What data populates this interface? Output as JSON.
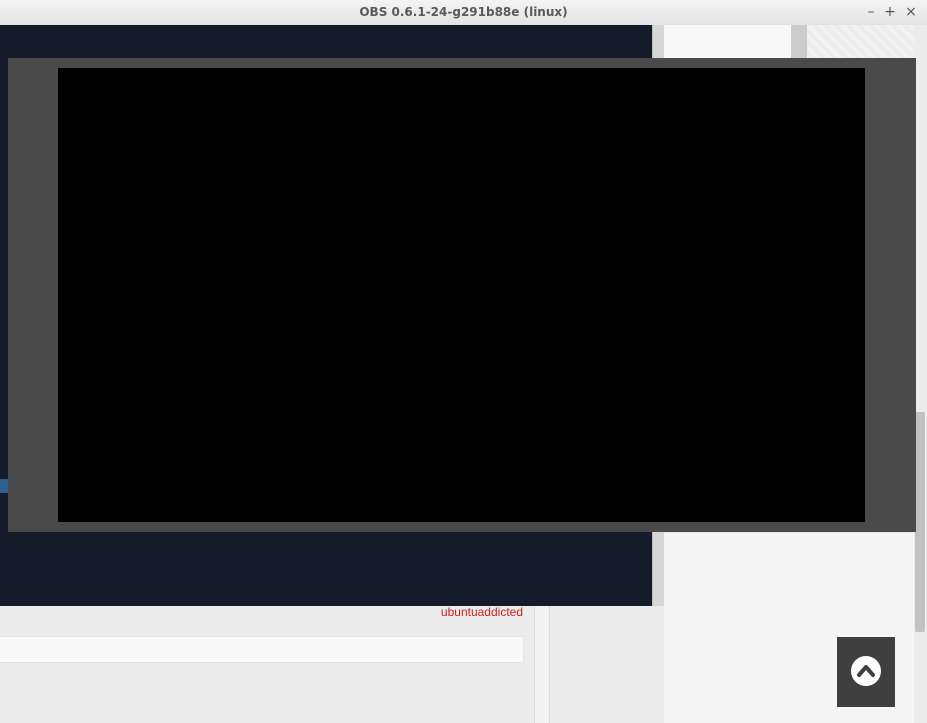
{
  "window": {
    "title": "OBS 0.6.1-24-g291b88e (linux)",
    "controls": {
      "minimize": "–",
      "maximize": "+",
      "close": "×"
    }
  },
  "page": {
    "username": "ubuntuaddicted",
    "comment_placeholder": ""
  },
  "colors": {
    "dark_bg": "#161b29",
    "preview_frame": "#4a4a4a",
    "username": "#cc1f1f"
  },
  "icons": {
    "back_to_top": "chevron-up-icon"
  }
}
